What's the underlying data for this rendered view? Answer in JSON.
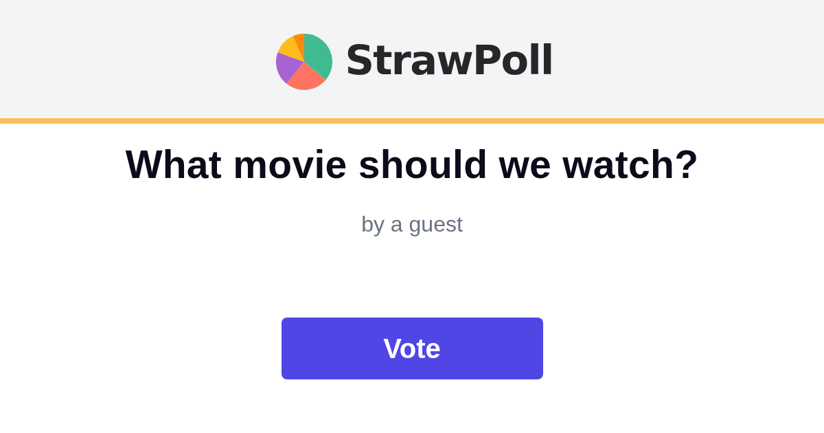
{
  "header": {
    "brand": "StrawPoll"
  },
  "poll": {
    "question": "What movie should we watch?",
    "author": "by a guest"
  },
  "vote_button": {
    "label": "Vote"
  }
}
